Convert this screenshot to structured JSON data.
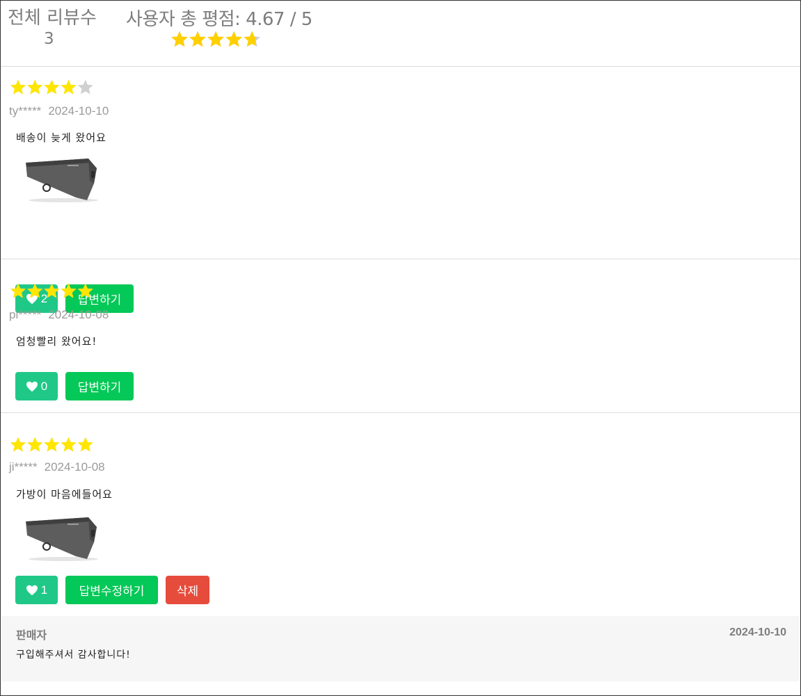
{
  "summary": {
    "total_label": "전체 리뷰수",
    "total_count": "3",
    "avg_label": "사용자 총 평점: 4.67 / 5",
    "avg_rating": 4.67
  },
  "colors": {
    "star_summary": "#ffd000",
    "star_review": "#ffe600",
    "star_empty": "#d0d0d0",
    "like": "#1fc887",
    "reply": "#04c857",
    "delete": "#e64c3c"
  },
  "reviews": [
    {
      "rating": 4,
      "user": "ty*****",
      "date": "2024-10-10",
      "content": "배송이 늦게 왔어요",
      "has_image": true,
      "like_count": "2",
      "reply_label": "답변하기"
    },
    {
      "rating": 5,
      "user": "pi*****",
      "date": "2024-10-08",
      "content": "엄청빨리 왔어요!",
      "has_image": false,
      "like_count": "0",
      "reply_label": "답변하기"
    },
    {
      "rating": 5,
      "user": "ji*****",
      "date": "2024-10-08",
      "content": "가방이 마음에들어요",
      "has_image": true,
      "like_count": "1",
      "reply_label": "답변수정하기",
      "delete_label": "삭제",
      "seller_reply": {
        "author": "판매자",
        "date": "2024-10-10",
        "text": "구입해주셔서 감사합니다!"
      }
    }
  ]
}
